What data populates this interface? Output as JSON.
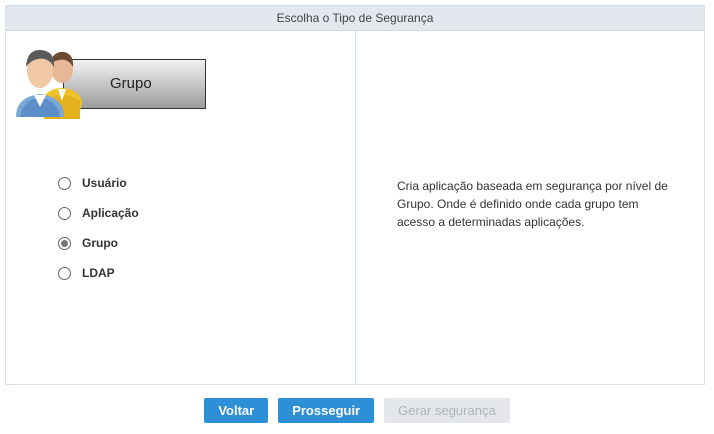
{
  "header": {
    "title": "Escolha o Tipo de Segurança"
  },
  "selected_type": {
    "label": "Grupo",
    "icon": "users-group-icon"
  },
  "options": [
    {
      "label": "Usuário",
      "checked": false
    },
    {
      "label": "Aplicação",
      "checked": false
    },
    {
      "label": "Grupo",
      "checked": true
    },
    {
      "label": "LDAP",
      "checked": false
    }
  ],
  "description": "Cria aplicação baseada em segurança por nível de Grupo. Onde é definido onde cada grupo tem acesso a determinadas aplicações.",
  "buttons": {
    "back": "Voltar",
    "next": "Prosseguir",
    "generate": "Gerar segurança"
  },
  "colors": {
    "accent": "#2d8fd5",
    "header_bg": "#e3e8ef",
    "disabled_bg": "#e3e6ea"
  }
}
